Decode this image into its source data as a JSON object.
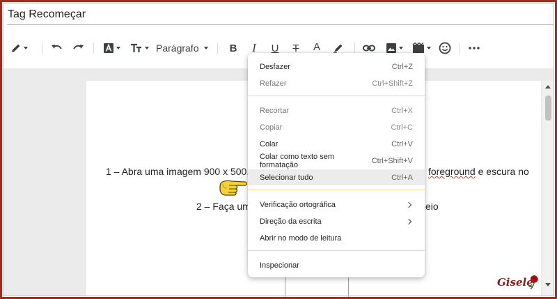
{
  "post_title": "Tag Recomeçar",
  "toolbar": {
    "paragraph_label": "Parágrafo",
    "bold_label": "B",
    "italic_label": "I",
    "underline_label": "U",
    "strike_label": "T",
    "textcolor_label": "A"
  },
  "document": {
    "line1_start": "1 – Abra uma imagem 900 x 500,",
    "line1_mid": "foreground",
    "line1_end": " e escura no",
    "line2_start": "2 – Faça um",
    "line2_end": "eio"
  },
  "context_menu": {
    "undo": {
      "label": "Desfazer",
      "shortcut": "Ctrl+Z"
    },
    "redo": {
      "label": "Refazer",
      "shortcut": "Ctrl+Shift+Z"
    },
    "cut": {
      "label": "Recortar",
      "shortcut": "Ctrl+X"
    },
    "copy": {
      "label": "Copiar",
      "shortcut": "Ctrl+C"
    },
    "paste": {
      "label": "Colar",
      "shortcut": "Ctrl+V"
    },
    "paste_plain": {
      "label": "Colar como texto sem formatação",
      "shortcut": "Ctrl+Shift+V"
    },
    "select_all": {
      "label": "Selecionar tudo",
      "shortcut": "Ctrl+A"
    },
    "spellcheck": {
      "label": "Verificação ortográfica"
    },
    "writing_direction": {
      "label": "Direção da escrita"
    },
    "reading_mode": {
      "label": "Abrir no modo de leitura"
    },
    "inspect": {
      "label": "Inspecionar"
    }
  },
  "signature": "Gisele",
  "colors": {
    "frame": "#a12a22",
    "title_underline": "#e8a57a",
    "menu_separator": "#f0dc9a",
    "spell_underline": "#d93025"
  }
}
